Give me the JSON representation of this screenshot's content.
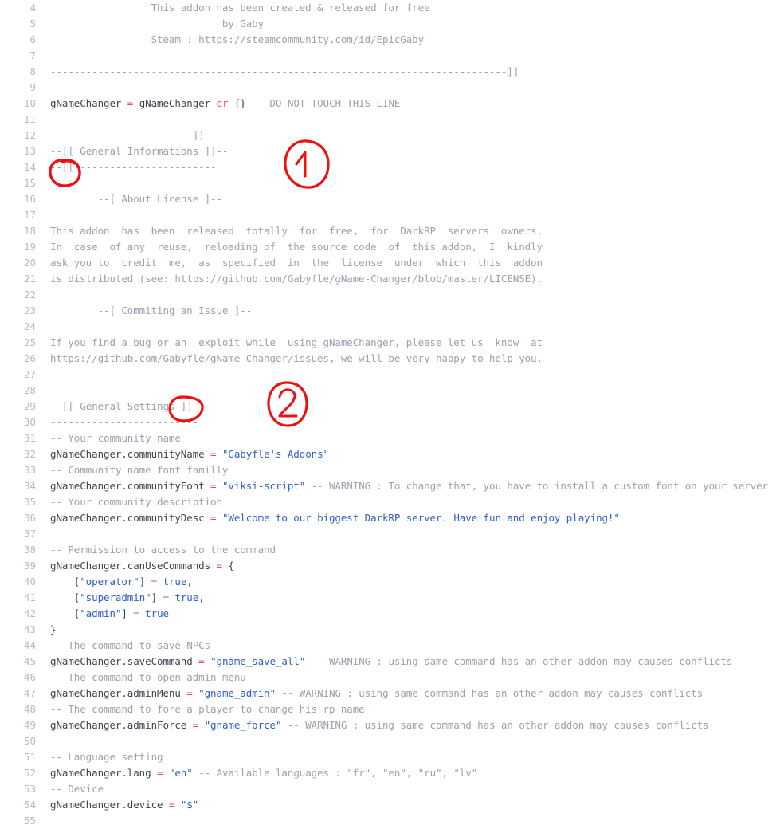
{
  "editor": {
    "name": "code-viewer",
    "language": "lua",
    "first_visible_line": 4,
    "last_visible_line": 55,
    "colors": {
      "background": "#ffffff",
      "line_number": "#b6bcc4",
      "text": "#3d4450",
      "comment": "#9aa2ad",
      "string": "#2f5ec4",
      "operator": "#e3457a",
      "annotation_red": "#ee1111"
    }
  },
  "lines": [
    {
      "n": "4",
      "tokens": [
        {
          "t": "comment",
          "s": "                 This addon has been created & released for free"
        }
      ]
    },
    {
      "n": "5",
      "tokens": [
        {
          "t": "comment",
          "s": "                             by Gaby"
        }
      ]
    },
    {
      "n": "6",
      "tokens": [
        {
          "t": "comment",
          "s": "                 Steam : https://steamcommunity.com/id/EpicGaby"
        }
      ]
    },
    {
      "n": "7",
      "tokens": [
        {
          "t": "comment",
          "s": ""
        }
      ]
    },
    {
      "n": "8",
      "tokens": [
        {
          "t": "comment",
          "s": "-----------------------------------------------------------------------------]]"
        }
      ]
    },
    {
      "n": "9",
      "tokens": [
        {
          "t": "comment",
          "s": ""
        }
      ]
    },
    {
      "n": "10",
      "tokens": [
        {
          "t": "plain",
          "s": "gNameChanger "
        },
        {
          "t": "operator",
          "s": "="
        },
        {
          "t": "plain",
          "s": " gNameChanger "
        },
        {
          "t": "keyword",
          "s": "or"
        },
        {
          "t": "plain",
          "s": " {} "
        },
        {
          "t": "comment",
          "s": "-- DO NOT TOUCH THIS LINE"
        }
      ]
    },
    {
      "n": "11",
      "tokens": [
        {
          "t": "comment",
          "s": ""
        }
      ]
    },
    {
      "n": "12",
      "tokens": [
        {
          "t": "comment",
          "s": "------------------------]]--"
        }
      ]
    },
    {
      "n": "13",
      "tokens": [
        {
          "t": "comment",
          "s": "--[[ General Informations ]]--"
        }
      ]
    },
    {
      "n": "14",
      "tokens": [
        {
          "t": "comment",
          "s": "--[[------------------------"
        }
      ]
    },
    {
      "n": "15",
      "tokens": [
        {
          "t": "comment",
          "s": ""
        }
      ]
    },
    {
      "n": "16",
      "tokens": [
        {
          "t": "comment",
          "s": "        --[ About License ]--"
        }
      ]
    },
    {
      "n": "17",
      "tokens": [
        {
          "t": "comment",
          "s": ""
        }
      ]
    },
    {
      "n": "18",
      "tokens": [
        {
          "t": "comment",
          "s": "This addon  has  been  released  totally  for  free,  for  DarkRP  servers  owners."
        }
      ]
    },
    {
      "n": "19",
      "tokens": [
        {
          "t": "comment",
          "s": "In  case  of any  reuse,  reloading of  the source code  of  this addon,  I  kindly"
        }
      ]
    },
    {
      "n": "20",
      "tokens": [
        {
          "t": "comment",
          "s": "ask you to  credit  me,  as  specified  in  the  license  under  which  this  addon"
        }
      ]
    },
    {
      "n": "21",
      "tokens": [
        {
          "t": "comment",
          "s": "is distributed (see: https://github.com/Gabyfle/gName-Changer/blob/master/LICENSE)."
        }
      ]
    },
    {
      "n": "22",
      "tokens": [
        {
          "t": "comment",
          "s": ""
        }
      ]
    },
    {
      "n": "23",
      "tokens": [
        {
          "t": "comment",
          "s": "        --[ Commiting an Issue ]--"
        }
      ]
    },
    {
      "n": "24",
      "tokens": [
        {
          "t": "comment",
          "s": ""
        }
      ]
    },
    {
      "n": "25",
      "tokens": [
        {
          "t": "comment",
          "s": "If you find a bug or an  exploit while  using gNameChanger, please let us  know  at"
        }
      ]
    },
    {
      "n": "26",
      "tokens": [
        {
          "t": "comment",
          "s": "https://github.com/Gabyfle/gName-Changer/issues, we will be very happy to help you."
        }
      ]
    },
    {
      "n": "27",
      "tokens": [
        {
          "t": "comment",
          "s": ""
        }
      ]
    },
    {
      "n": "28",
      "tokens": [
        {
          "t": "comment",
          "s": "-------------------------"
        }
      ]
    },
    {
      "n": "29",
      "tokens": [
        {
          "t": "comment",
          "s": "--[[ General Settings ]]--"
        }
      ]
    },
    {
      "n": "30",
      "tokens": [
        {
          "t": "comment",
          "s": "-------------------------"
        }
      ]
    },
    {
      "n": "31",
      "tokens": [
        {
          "t": "comment",
          "s": "-- Your community name"
        }
      ]
    },
    {
      "n": "32",
      "tokens": [
        {
          "t": "plain",
          "s": "gNameChanger.communityName "
        },
        {
          "t": "operator",
          "s": "="
        },
        {
          "t": "plain",
          "s": " "
        },
        {
          "t": "string",
          "s": "\"Gabyfle's Addons\""
        }
      ]
    },
    {
      "n": "33",
      "tokens": [
        {
          "t": "comment",
          "s": "-- Community name font familly"
        }
      ]
    },
    {
      "n": "34",
      "tokens": [
        {
          "t": "plain",
          "s": "gNameChanger.communityFont "
        },
        {
          "t": "operator",
          "s": "="
        },
        {
          "t": "plain",
          "s": " "
        },
        {
          "t": "string",
          "s": "\"viksi-script\""
        },
        {
          "t": "plain",
          "s": " "
        },
        {
          "t": "comment",
          "s": "-- WARNING : To change that, you have to install a custom font on your server"
        }
      ]
    },
    {
      "n": "35",
      "tokens": [
        {
          "t": "comment",
          "s": "-- Your community description"
        }
      ]
    },
    {
      "n": "36",
      "tokens": [
        {
          "t": "plain",
          "s": "gNameChanger.communityDesc "
        },
        {
          "t": "operator",
          "s": "="
        },
        {
          "t": "plain",
          "s": " "
        },
        {
          "t": "string",
          "s": "\"Welcome to our biggest DarkRP server. Have fun and enjoy playing!\""
        }
      ]
    },
    {
      "n": "37",
      "tokens": [
        {
          "t": "comment",
          "s": ""
        }
      ]
    },
    {
      "n": "38",
      "tokens": [
        {
          "t": "comment",
          "s": "-- Permission to access to the command"
        }
      ]
    },
    {
      "n": "39",
      "tokens": [
        {
          "t": "plain",
          "s": "gNameChanger.canUseCommands "
        },
        {
          "t": "operator",
          "s": "="
        },
        {
          "t": "plain",
          "s": " {"
        }
      ]
    },
    {
      "n": "40",
      "tokens": [
        {
          "t": "plain",
          "s": "    ["
        },
        {
          "t": "string",
          "s": "\"operator\""
        },
        {
          "t": "plain",
          "s": "] "
        },
        {
          "t": "operator",
          "s": "="
        },
        {
          "t": "plain",
          "s": " "
        },
        {
          "t": "bool",
          "s": "true"
        },
        {
          "t": "plain",
          "s": ","
        }
      ]
    },
    {
      "n": "41",
      "tokens": [
        {
          "t": "plain",
          "s": "    ["
        },
        {
          "t": "string",
          "s": "\"superadmin\""
        },
        {
          "t": "plain",
          "s": "] "
        },
        {
          "t": "operator",
          "s": "="
        },
        {
          "t": "plain",
          "s": " "
        },
        {
          "t": "bool",
          "s": "true"
        },
        {
          "t": "plain",
          "s": ","
        }
      ]
    },
    {
      "n": "42",
      "tokens": [
        {
          "t": "plain",
          "s": "    ["
        },
        {
          "t": "string",
          "s": "\"admin\""
        },
        {
          "t": "plain",
          "s": "] "
        },
        {
          "t": "operator",
          "s": "="
        },
        {
          "t": "plain",
          "s": " "
        },
        {
          "t": "bool",
          "s": "true"
        }
      ]
    },
    {
      "n": "43",
      "tokens": [
        {
          "t": "plain",
          "s": "}"
        }
      ]
    },
    {
      "n": "44",
      "tokens": [
        {
          "t": "comment",
          "s": "-- The command to save NPCs"
        }
      ]
    },
    {
      "n": "45",
      "tokens": [
        {
          "t": "plain",
          "s": "gNameChanger.saveCommand "
        },
        {
          "t": "operator",
          "s": "="
        },
        {
          "t": "plain",
          "s": " "
        },
        {
          "t": "string",
          "s": "\"gname_save_all\""
        },
        {
          "t": "plain",
          "s": " "
        },
        {
          "t": "comment",
          "s": "-- WARNING : using same command has an other addon may causes conflicts"
        }
      ]
    },
    {
      "n": "46",
      "tokens": [
        {
          "t": "comment",
          "s": "-- The command to open admin menu"
        }
      ]
    },
    {
      "n": "47",
      "tokens": [
        {
          "t": "plain",
          "s": "gNameChanger.adminMenu "
        },
        {
          "t": "operator",
          "s": "="
        },
        {
          "t": "plain",
          "s": " "
        },
        {
          "t": "string",
          "s": "\"gname_admin\""
        },
        {
          "t": "plain",
          "s": " "
        },
        {
          "t": "comment",
          "s": "-- WARNING : using same command has an other addon may causes conflicts"
        }
      ]
    },
    {
      "n": "48",
      "tokens": [
        {
          "t": "comment",
          "s": "-- The command to fore a player to change his rp name"
        }
      ]
    },
    {
      "n": "49",
      "tokens": [
        {
          "t": "plain",
          "s": "gNameChanger.adminForce "
        },
        {
          "t": "operator",
          "s": "="
        },
        {
          "t": "plain",
          "s": " "
        },
        {
          "t": "string",
          "s": "\"gname_force\""
        },
        {
          "t": "plain",
          "s": " "
        },
        {
          "t": "comment",
          "s": "-- WARNING : using same command has an other addon may causes conflicts"
        }
      ]
    },
    {
      "n": "50",
      "tokens": [
        {
          "t": "comment",
          "s": ""
        }
      ]
    },
    {
      "n": "51",
      "tokens": [
        {
          "t": "comment",
          "s": "-- Language setting"
        }
      ]
    },
    {
      "n": "52",
      "tokens": [
        {
          "t": "plain",
          "s": "gNameChanger.lang "
        },
        {
          "t": "operator",
          "s": "="
        },
        {
          "t": "plain",
          "s": " "
        },
        {
          "t": "string",
          "s": "\"en\""
        },
        {
          "t": "plain",
          "s": " "
        },
        {
          "t": "comment",
          "s": "-- Available languages : \"fr\", \"en\", \"ru\", \"lv\""
        }
      ]
    },
    {
      "n": "53",
      "tokens": [
        {
          "t": "comment",
          "s": "-- Device"
        }
      ]
    },
    {
      "n": "54",
      "tokens": [
        {
          "t": "plain",
          "s": "gNameChanger.device "
        },
        {
          "t": "operator",
          "s": "="
        },
        {
          "t": "plain",
          "s": " "
        },
        {
          "t": "string",
          "s": "\"$\""
        }
      ]
    },
    {
      "n": "55",
      "tokens": [
        {
          "t": "comment",
          "s": ""
        }
      ]
    }
  ],
  "annotations": [
    {
      "id": "circle-open-bracket-line14",
      "kind": "ellipse-highlight",
      "target_line": "14",
      "target_text": "--[["
    },
    {
      "id": "callout-1",
      "kind": "numbered-circle",
      "label": "1"
    },
    {
      "id": "circle-close-bracket-line29",
      "kind": "ellipse-highlight",
      "target_line": "29",
      "target_text": "]]"
    },
    {
      "id": "callout-2",
      "kind": "numbered-circle",
      "label": "2"
    }
  ]
}
